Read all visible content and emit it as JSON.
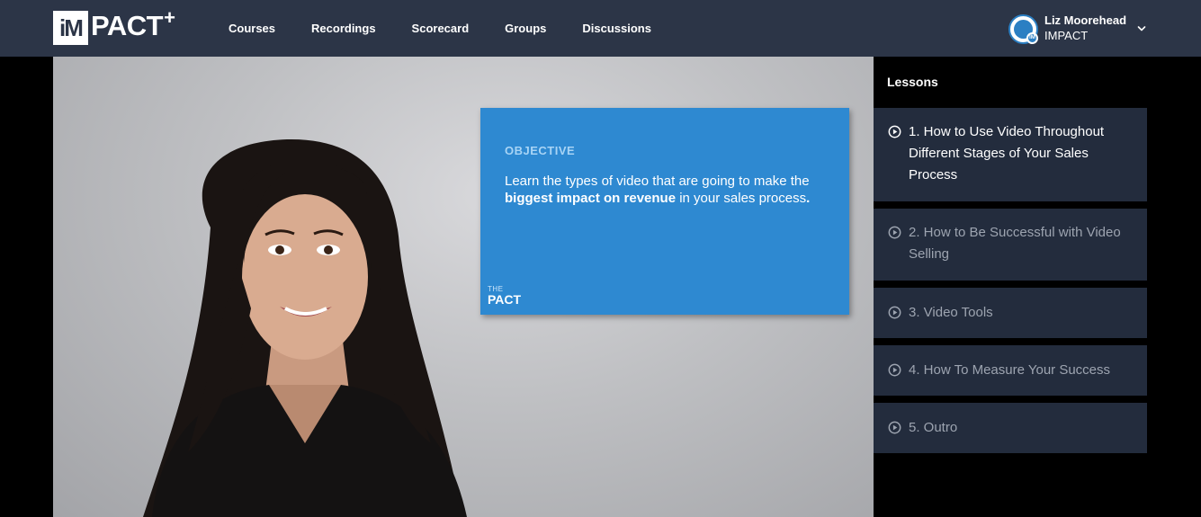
{
  "brand": {
    "logo_box": "iM",
    "logo_text": "PACT",
    "logo_plus": "+"
  },
  "nav": {
    "items": [
      {
        "label": "Courses"
      },
      {
        "label": "Recordings"
      },
      {
        "label": "Scorecard"
      },
      {
        "label": "Groups"
      },
      {
        "label": "Discussions"
      }
    ]
  },
  "user": {
    "name": "Liz Moorehead",
    "org": "IMPACT",
    "avatar_badge": "IM"
  },
  "video": {
    "objective": {
      "heading": "OBJECTIVE",
      "body_pre": "Learn the types of video that are going to make the ",
      "body_bold": "biggest impact on revenue",
      "body_post": " in your sales process",
      "body_end": ".",
      "brand_small": "THE",
      "brand": "PACT"
    }
  },
  "sidebar": {
    "title": "Lessons",
    "lessons": [
      {
        "label": "1. How to Use Video Throughout Different Stages of Your Sales Process",
        "active": true
      },
      {
        "label": "2. How to Be Successful with Video Selling",
        "active": false
      },
      {
        "label": "3. Video Tools",
        "active": false
      },
      {
        "label": "4. How To Measure Your Success",
        "active": false
      },
      {
        "label": "5. Outro",
        "active": false
      }
    ]
  },
  "colors": {
    "topbar": "#2c3547",
    "card": "#2e89d1",
    "lesson_bg": "#232c3d"
  }
}
